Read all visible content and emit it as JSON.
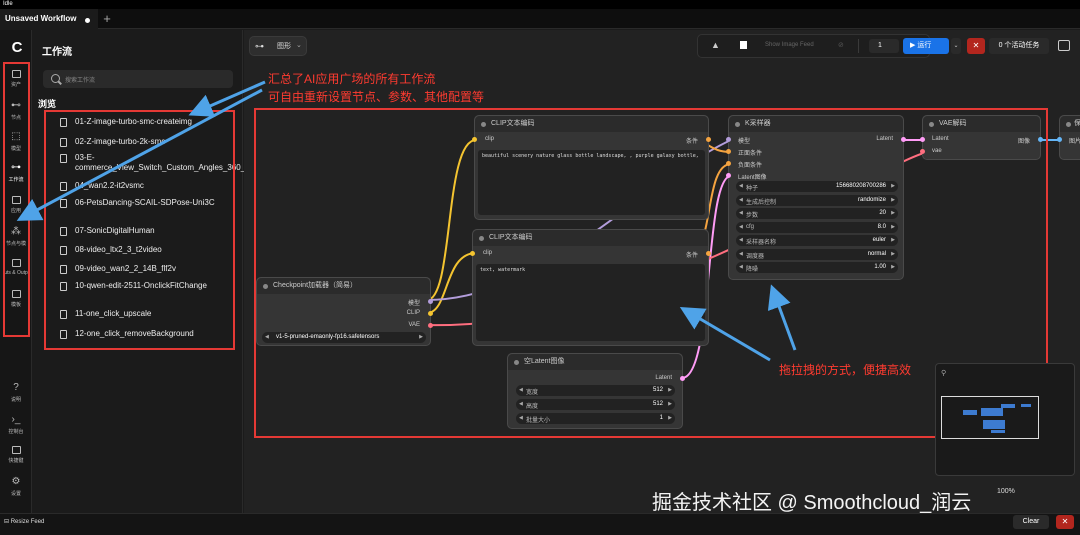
{
  "status": "Idle",
  "tabs": [
    {
      "label": "Unsaved Workflow"
    }
  ],
  "rail": [
    {
      "label": "资产",
      "icon": "image-icon"
    },
    {
      "label": "节点",
      "icon": "node-icon"
    },
    {
      "label": "模型",
      "icon": "model-icon"
    },
    {
      "label": "工作流",
      "icon": "workflow-icon"
    },
    {
      "label": "应用",
      "icon": "app-icon"
    },
    {
      "label": "节点与模",
      "icon": "library-icon"
    },
    {
      "label": "uts & Outp",
      "icon": "io-icon"
    },
    {
      "label": "模板",
      "icon": "template-icon"
    },
    {
      "label": "说明",
      "icon": "help-icon"
    },
    {
      "label": "控制台",
      "icon": "console-icon"
    },
    {
      "label": "快捷键",
      "icon": "keyboard-icon"
    },
    {
      "label": "设置",
      "icon": "settings-icon"
    }
  ],
  "panel": {
    "title": "工作流",
    "search_placeholder": "搜索工作流",
    "browse": "浏览",
    "items": [
      "01-Z-image-turbo-smc-createimg",
      "02-Z-image-turbo-2k-smc",
      "03-E-commerce_View_Switch_Custom_Angles_360_Control",
      "04_wan2.2-it2vsmc",
      "06-PetsDancing-SCAIL-SDPose-Uni3C",
      "07-SonicDigitalHuman",
      "08-video_ltx2_3_t2video",
      "09-video_wan2_2_14B_flf2v",
      "10-qwen-edit-2511-OnclickFitChange",
      "11-one_click_upscale",
      "12-one_click_removeBackground"
    ]
  },
  "canvas": {
    "view_label": "图形",
    "toolbar": {
      "feed": "Show Image Feed",
      "count": "1",
      "run": "运行",
      "stop": "✕",
      "active": "0 个活动任务"
    },
    "zoom": "100%"
  },
  "nodes": {
    "clip1": {
      "title": "CLIP文本编码",
      "in": "clip",
      "out": "条件",
      "text": "beautiful scenery nature glass bottle landscape, , purple galaxy bottle,"
    },
    "clip2": {
      "title": "CLIP文本编码",
      "in": "clip",
      "out": "条件",
      "text": "text, watermark"
    },
    "ckpt": {
      "title": "Checkpoint加载器（简易）",
      "outs": [
        "模型",
        "CLIP",
        "VAE"
      ],
      "model": "v1-5-pruned-emaonly-fp16.safetensors"
    },
    "latent": {
      "title": "空Latent图像",
      "out": "Latent",
      "fields": [
        {
          "label": "宽度",
          "value": "512"
        },
        {
          "label": "高度",
          "value": "512"
        },
        {
          "label": "批量大小",
          "value": "1"
        }
      ]
    },
    "ksampler": {
      "title": "K采样器",
      "ins": [
        "模型",
        "正面条件",
        "负面条件",
        "Latent图像"
      ],
      "out": "Latent",
      "fields": [
        {
          "label": "种子",
          "value": "156680208700286"
        },
        {
          "label": "生成后控制",
          "value": "randomize"
        },
        {
          "label": "步数",
          "value": "20"
        },
        {
          "label": "cfg",
          "value": "8.0"
        },
        {
          "label": "采样器名称",
          "value": "euler"
        },
        {
          "label": "调度器",
          "value": "normal"
        },
        {
          "label": "降噪",
          "value": "1.00"
        }
      ]
    },
    "vae": {
      "title": "VAE解码",
      "ins": [
        "Latent",
        "vae"
      ],
      "out": "图像"
    },
    "save": {
      "title": "保",
      "in": "图片"
    }
  },
  "notes": {
    "top1": "汇总了AI应用广场的所有工作流",
    "top2": "可自由重新设置节点、参数、其他配置等",
    "drag": "拖拉拽的方式，便捷高效"
  },
  "watermark": "掘金技术社区 @ Smoothcloud_润云",
  "bottom": {
    "resize": "Resize Feed",
    "clear": "Clear",
    "close": "✕"
  },
  "colors": {
    "accent": "#1a73e8",
    "annotation": "#ff3b30",
    "clip_wire": "#f4c430",
    "model_wire": "#b39ddb",
    "vae_wire": "#ff6e7f",
    "latent_wire": "#ff9cf6"
  }
}
